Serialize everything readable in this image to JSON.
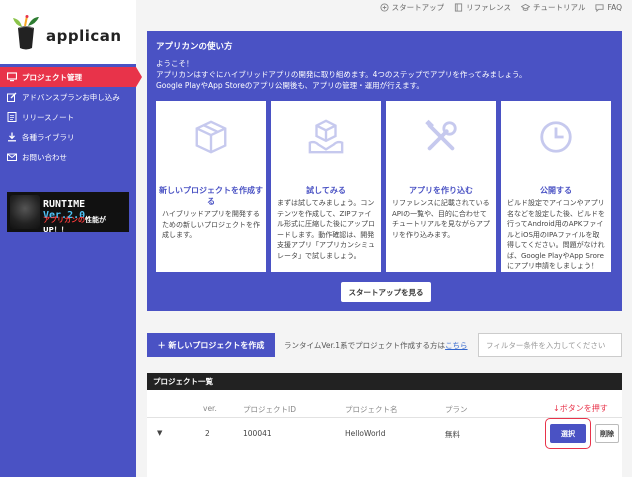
{
  "brand": {
    "logo_text": "applican"
  },
  "topbar": {
    "items": [
      {
        "label": "スタートアップ",
        "icon": "startup-icon"
      },
      {
        "label": "リファレンス",
        "icon": "book-icon"
      },
      {
        "label": "チュートリアル",
        "icon": "tutorial-icon"
      },
      {
        "label": "FAQ",
        "icon": "faq-icon"
      }
    ]
  },
  "sidebar": {
    "items": [
      {
        "label": "プロジェクト管理",
        "icon": "monitor-icon",
        "active": true
      },
      {
        "label": "アドバンスプランお申し込み",
        "icon": "edit-icon",
        "active": false
      },
      {
        "label": "リリースノート",
        "icon": "note-icon",
        "active": false
      },
      {
        "label": "各種ライブラリ",
        "icon": "download-icon",
        "active": false
      },
      {
        "label": "お問い合わせ",
        "icon": "mail-icon",
        "active": false
      }
    ],
    "banner": {
      "title_a": "RUNTIME ",
      "title_b": "Ver.2.0",
      "sub_a": "アプリカンの",
      "sub_b": "性能が UP！！"
    }
  },
  "intro": {
    "title": "アプリカンの使い方",
    "line1": "ようこそ！",
    "line2": "アプリカンはすぐにハイブリッドアプリの開発に取り組めます。4つのステップでアプリを作ってみましょう。",
    "line3": "Google PlayやApp Storeのアプリ公開後も、アプリの管理・運用が行えます。",
    "cards": [
      {
        "icon": "box-icon",
        "title": "新しいプロジェクトを作成する",
        "body": "ハイブリッドアプリを開発するための新しいプロジェクトを作成します。"
      },
      {
        "icon": "package-hands-icon",
        "title": "試してみる",
        "body": "まずは試してみましょう。コンテンツを作成して、ZIPファイル形式に圧縮した後にアップロードします。動作確認は、開発支援アプリ「アプリカンシミュレータ」で試しましょう。"
      },
      {
        "icon": "tools-icon",
        "title": "アプリを作り込む",
        "body": "リファレンスに記載されているAPIの一覧や、目的に合わせてチュートリアルを見ながらアプリを作り込みます。"
      },
      {
        "icon": "clock-icon",
        "title": "公開する",
        "body": "ビルド設定でアイコンやアプリ名などを設定した後、ビルドを行ってAndroid用のAPKファイルとiOS用のIPAファイルを取得してください。問題がなければ、Google PlayやApp Sroreにアプリ申請をしましょう！"
      }
    ],
    "startup_button": "スタートアップを見る"
  },
  "actions": {
    "new_project": "＋ 新しいプロジェクトを作成",
    "runtime_note": "ランタイムVer.1系でプロジェクト作成する方は",
    "runtime_link": "こちら",
    "filter_placeholder": "フィルター条件を入力してください"
  },
  "projects": {
    "header": "プロジェクト一覧",
    "columns": [
      "ver.",
      "プロジェクトID",
      "プロジェクト名",
      "プラン"
    ],
    "rows": [
      {
        "toggle": "▼",
        "ver": "2",
        "id": "100041",
        "name": "HelloWorld",
        "plan": "無料",
        "select": "選択",
        "delete": "削除"
      }
    ],
    "annotation": "↓ボタンを押す"
  },
  "colors": {
    "primary": "#4a52c4",
    "accent": "#e8334a",
    "dark": "#222222"
  }
}
